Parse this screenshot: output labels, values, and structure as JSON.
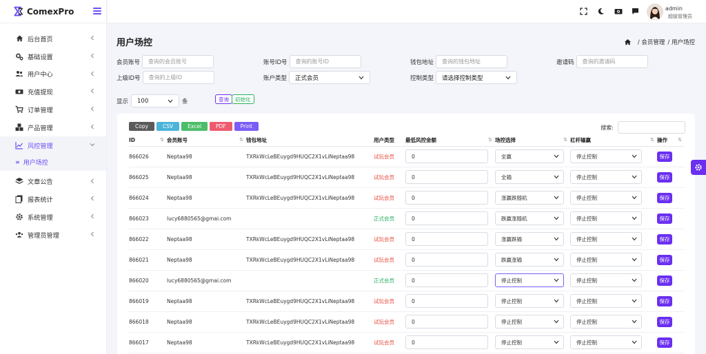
{
  "brand": {
    "name": "ComexPro"
  },
  "sidebar": {
    "items": [
      {
        "label": "后台首页",
        "icon": "home-icon"
      },
      {
        "label": "基础设置",
        "icon": "cogs-icon"
      },
      {
        "label": "用户中心",
        "icon": "users-icon"
      },
      {
        "label": "充值提现",
        "icon": "money-icon"
      },
      {
        "label": "订单管理",
        "icon": "cart-icon"
      },
      {
        "label": "产品管理",
        "icon": "cubes-icon"
      },
      {
        "label": "风控管理",
        "icon": "chart-icon"
      },
      {
        "label": "文章公告",
        "icon": "layers-icon"
      },
      {
        "label": "报表统计",
        "icon": "files-icon"
      },
      {
        "label": "系统管理",
        "icon": "gear-icon"
      },
      {
        "label": "管理员管理",
        "icon": "admin-users-icon"
      }
    ],
    "sub_item": "用户场控",
    "sub_dot": "≡"
  },
  "header": {
    "user_name": "admin",
    "user_role": "超级管理员"
  },
  "page": {
    "title": "用户场控",
    "breadcrumb": [
      "/ 会员管理",
      "/ 用户场控"
    ]
  },
  "filters": {
    "member_account_label": "会员账号",
    "member_account_placeholder": "查询的会员账号",
    "account_id_label": "账号ID号",
    "account_id_placeholder": "查询的账号ID",
    "wallet_label": "钱包地址",
    "wallet_placeholder": "查询的钱包地址",
    "invite_label": "邀请码",
    "invite_placeholder": "查询的邀请码",
    "parent_id_label": "上级ID号",
    "parent_id_placeholder": "查询的上级ID",
    "account_type_label": "账户类型",
    "account_type_value": "正式会员",
    "control_type_label": "控制类型",
    "control_type_value": "请选择控制类型"
  },
  "show": {
    "prefix": "显示",
    "value": "100",
    "suffix": "条"
  },
  "actions": {
    "query": "查询",
    "reset": "初始化"
  },
  "export": {
    "copy": "Copy",
    "csv": "CSV",
    "excel": "Excel",
    "pdf": "PDF",
    "print": "Print"
  },
  "search_label": "搜索:",
  "table": {
    "headers": [
      "ID",
      "会员账号",
      "钱包地址",
      "用户类型",
      "最低风控金额",
      "场控选择",
      "杠杆输赢",
      "操作"
    ],
    "rows": [
      {
        "id": "866026",
        "account": "Neptaa98",
        "wallet": "TXRkWcLeBEuygd9HUQC2X1vLiNeptaa98",
        "type": "试玩会员",
        "trial": true,
        "amount": "0",
        "control": "全赢",
        "leverage": "停止控制",
        "save": "保存"
      },
      {
        "id": "866025",
        "account": "Neptaa98",
        "wallet": "TXRkWcLeBEuygd9HUQC2X1vLiNeptaa98",
        "type": "试玩会员",
        "trial": true,
        "amount": "0",
        "control": "全输",
        "leverage": "停止控制",
        "save": "保存"
      },
      {
        "id": "866024",
        "account": "Neptaa98",
        "wallet": "TXRkWcLeBEuygd9HUQC2X1vLiNeptaa98",
        "type": "试玩会员",
        "trial": true,
        "amount": "0",
        "control": "涨赢跌随机",
        "leverage": "停止控制",
        "save": "保存"
      },
      {
        "id": "866023",
        "account": "lucy6880565@gmai.com",
        "wallet": "",
        "type": "正式会员",
        "trial": false,
        "amount": "0",
        "control": "跌赢涨随机",
        "leverage": "停止控制",
        "save": "保存"
      },
      {
        "id": "866022",
        "account": "Neptaa98",
        "wallet": "TXRkWcLeBEuygd9HUQC2X1vLiNeptaa98",
        "type": "试玩会员",
        "trial": true,
        "amount": "0",
        "control": "涨赢跌输",
        "leverage": "停止控制",
        "save": "保存"
      },
      {
        "id": "866021",
        "account": "Neptaa98",
        "wallet": "TXRkWcLeBEuygd9HUQC2X1vLiNeptaa98",
        "type": "试玩会员",
        "trial": true,
        "amount": "0",
        "control": "跌赢涨输",
        "leverage": "停止控制",
        "save": "保存"
      },
      {
        "id": "866020",
        "account": "lucy6880565@gmai.com",
        "wallet": "",
        "type": "正式会员",
        "trial": false,
        "amount": "0",
        "control": "停止控制",
        "leverage": "停止控制",
        "save": "保存"
      },
      {
        "id": "866019",
        "account": "Neptaa98",
        "wallet": "TXRkWcLeBEuygd9HUQC2X1vLiNeptaa98",
        "type": "试玩会员",
        "trial": true,
        "amount": "0",
        "control": "停止控制",
        "leverage": "停止控制",
        "save": "保存"
      },
      {
        "id": "866018",
        "account": "Neptaa98",
        "wallet": "TXRkWcLeBEuygd9HUQC2X1vLiNeptaa98",
        "type": "试玩会员",
        "trial": true,
        "amount": "0",
        "control": "停止控制",
        "leverage": "停止控制",
        "save": "保存"
      },
      {
        "id": "866017",
        "account": "Neptaa98",
        "wallet": "TXRkWcLeBEuygd9HUQC2X1vLiNeptaa98",
        "type": "试玩会员",
        "trial": true,
        "amount": "0",
        "control": "停止控制",
        "leverage": "停止控制",
        "save": "保存"
      }
    ]
  },
  "colors": {
    "accent": "#6a2ff0",
    "trial": "#e74c3c",
    "formal": "#27ae60"
  }
}
